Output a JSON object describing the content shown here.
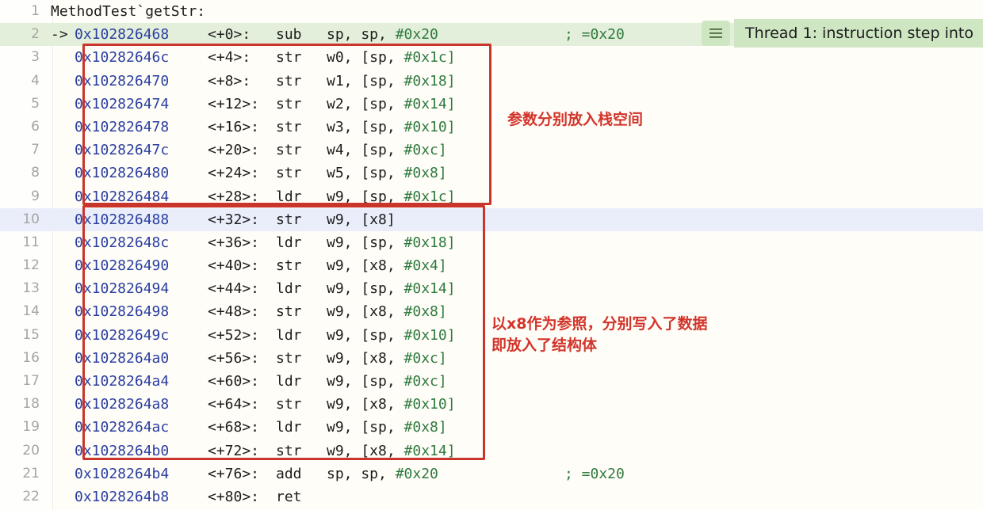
{
  "view": {
    "title": "disassembly-view",
    "function_header": "MethodTest`getStr:",
    "colors": {
      "background": "#fffdf7",
      "current_line": "#e3efda",
      "selected_line": "#e9eefa",
      "address": "#2a3ea0",
      "immediate": "#2f7a3f",
      "annotation_red": "#d2342a",
      "box_red": "#c9352a",
      "badge_green": "#cfe6c3"
    }
  },
  "thread_badge": {
    "icon": "hamburger-menu-icon",
    "label": "Thread 1: instruction step into"
  },
  "annotations": [
    {
      "id": "params",
      "text": "参数分别放入栈空间"
    },
    {
      "id": "struct",
      "text": "以x8作为参照，分别写入了数据\n即放入了结构体"
    }
  ],
  "lines": [
    {
      "n": "1",
      "arrow": "",
      "address": "",
      "offset": "",
      "mnemonic": "",
      "operands": "",
      "comment": "",
      "header": "MethodTest`getStr:",
      "state": "normal"
    },
    {
      "n": "2",
      "arrow": "->",
      "address": "0x102826468",
      "offset": "<+0>:",
      "mnemonic": "sub",
      "operands": "sp, sp, ",
      "immediate": "#0x20",
      "comment": ";  =0x20",
      "state": "current"
    },
    {
      "n": "3",
      "arrow": "",
      "address": "0x10282646c",
      "offset": "<+4>:",
      "mnemonic": "str",
      "operands": "w0, [sp, ",
      "immediate": "#0x1c]",
      "comment": "",
      "state": "normal"
    },
    {
      "n": "4",
      "arrow": "",
      "address": "0x102826470",
      "offset": "<+8>:",
      "mnemonic": "str",
      "operands": "w1, [sp, ",
      "immediate": "#0x18]",
      "comment": "",
      "state": "normal"
    },
    {
      "n": "5",
      "arrow": "",
      "address": "0x102826474",
      "offset": "<+12>:",
      "mnemonic": "str",
      "operands": "w2, [sp, ",
      "immediate": "#0x14]",
      "comment": "",
      "state": "normal"
    },
    {
      "n": "6",
      "arrow": "",
      "address": "0x102826478",
      "offset": "<+16>:",
      "mnemonic": "str",
      "operands": "w3, [sp, ",
      "immediate": "#0x10]",
      "comment": "",
      "state": "normal"
    },
    {
      "n": "7",
      "arrow": "",
      "address": "0x10282647c",
      "offset": "<+20>:",
      "mnemonic": "str",
      "operands": "w4, [sp, ",
      "immediate": "#0xc]",
      "comment": "",
      "state": "normal"
    },
    {
      "n": "8",
      "arrow": "",
      "address": "0x102826480",
      "offset": "<+24>:",
      "mnemonic": "str",
      "operands": "w5, [sp, ",
      "immediate": "#0x8]",
      "comment": "",
      "state": "normal"
    },
    {
      "n": "9",
      "arrow": "",
      "address": "0x102826484",
      "offset": "<+28>:",
      "mnemonic": "ldr",
      "operands": "w9, [sp, ",
      "immediate": "#0x1c]",
      "comment": "",
      "state": "normal"
    },
    {
      "n": "10",
      "arrow": "",
      "address": "0x102826488",
      "offset": "<+32>:",
      "mnemonic": "str",
      "operands": "w9, [x8]",
      "immediate": "",
      "comment": "",
      "state": "selected"
    },
    {
      "n": "11",
      "arrow": "",
      "address": "0x10282648c",
      "offset": "<+36>:",
      "mnemonic": "ldr",
      "operands": "w9, [sp, ",
      "immediate": "#0x18]",
      "comment": "",
      "state": "normal"
    },
    {
      "n": "12",
      "arrow": "",
      "address": "0x102826490",
      "offset": "<+40>:",
      "mnemonic": "str",
      "operands": "w9, [x8, ",
      "immediate": "#0x4]",
      "comment": "",
      "state": "normal"
    },
    {
      "n": "13",
      "arrow": "",
      "address": "0x102826494",
      "offset": "<+44>:",
      "mnemonic": "ldr",
      "operands": "w9, [sp, ",
      "immediate": "#0x14]",
      "comment": "",
      "state": "normal"
    },
    {
      "n": "14",
      "arrow": "",
      "address": "0x102826498",
      "offset": "<+48>:",
      "mnemonic": "str",
      "operands": "w9, [x8, ",
      "immediate": "#0x8]",
      "comment": "",
      "state": "normal"
    },
    {
      "n": "15",
      "arrow": "",
      "address": "0x10282649c",
      "offset": "<+52>:",
      "mnemonic": "ldr",
      "operands": "w9, [sp, ",
      "immediate": "#0x10]",
      "comment": "",
      "state": "normal"
    },
    {
      "n": "16",
      "arrow": "",
      "address": "0x1028264a0",
      "offset": "<+56>:",
      "mnemonic": "str",
      "operands": "w9, [x8, ",
      "immediate": "#0xc]",
      "comment": "",
      "state": "normal"
    },
    {
      "n": "17",
      "arrow": "",
      "address": "0x1028264a4",
      "offset": "<+60>:",
      "mnemonic": "ldr",
      "operands": "w9, [sp, ",
      "immediate": "#0xc]",
      "comment": "",
      "state": "normal"
    },
    {
      "n": "18",
      "arrow": "",
      "address": "0x1028264a8",
      "offset": "<+64>:",
      "mnemonic": "str",
      "operands": "w9, [x8, ",
      "immediate": "#0x10]",
      "comment": "",
      "state": "normal"
    },
    {
      "n": "19",
      "arrow": "",
      "address": "0x1028264ac",
      "offset": "<+68>:",
      "mnemonic": "ldr",
      "operands": "w9, [sp, ",
      "immediate": "#0x8]",
      "comment": "",
      "state": "normal"
    },
    {
      "n": "20",
      "arrow": "",
      "address": "0x1028264b0",
      "offset": "<+72>:",
      "mnemonic": "str",
      "operands": "w9, [x8, ",
      "immediate": "#0x14]",
      "comment": "",
      "state": "normal"
    },
    {
      "n": "21",
      "arrow": "",
      "address": "0x1028264b4",
      "offset": "<+76>:",
      "mnemonic": "add",
      "operands": "sp, sp, ",
      "immediate": "#0x20",
      "comment": ";  =0x20",
      "state": "normal"
    },
    {
      "n": "22",
      "arrow": "",
      "address": "0x1028264b8",
      "offset": "<+80>:",
      "mnemonic": "ret",
      "operands": "",
      "immediate": "",
      "comment": "",
      "state": "normal"
    }
  ]
}
